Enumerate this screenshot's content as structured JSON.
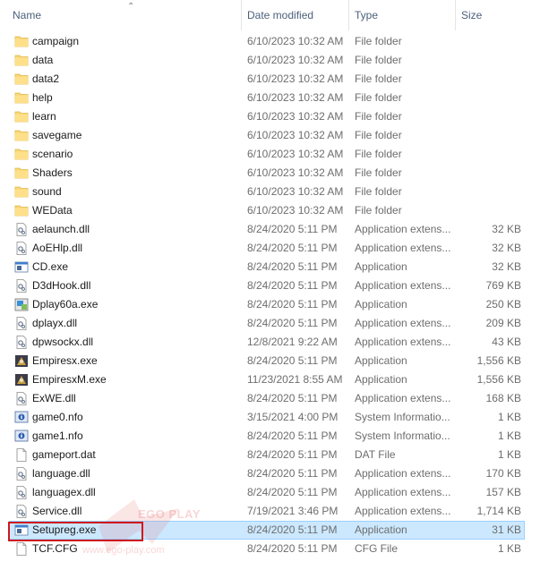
{
  "columns": {
    "name": "Name",
    "date": "Date modified",
    "type": "Type",
    "size": "Size"
  },
  "rows": [
    {
      "name": "campaign",
      "date": "6/10/2023 10:32 AM",
      "type": "File folder",
      "size": "",
      "icon": "folder"
    },
    {
      "name": "data",
      "date": "6/10/2023 10:32 AM",
      "type": "File folder",
      "size": "",
      "icon": "folder"
    },
    {
      "name": "data2",
      "date": "6/10/2023 10:32 AM",
      "type": "File folder",
      "size": "",
      "icon": "folder"
    },
    {
      "name": "help",
      "date": "6/10/2023 10:32 AM",
      "type": "File folder",
      "size": "",
      "icon": "folder"
    },
    {
      "name": "learn",
      "date": "6/10/2023 10:32 AM",
      "type": "File folder",
      "size": "",
      "icon": "folder"
    },
    {
      "name": "savegame",
      "date": "6/10/2023 10:32 AM",
      "type": "File folder",
      "size": "",
      "icon": "folder"
    },
    {
      "name": "scenario",
      "date": "6/10/2023 10:32 AM",
      "type": "File folder",
      "size": "",
      "icon": "folder"
    },
    {
      "name": "Shaders",
      "date": "6/10/2023 10:32 AM",
      "type": "File folder",
      "size": "",
      "icon": "folder"
    },
    {
      "name": "sound",
      "date": "6/10/2023 10:32 AM",
      "type": "File folder",
      "size": "",
      "icon": "folder"
    },
    {
      "name": "WEData",
      "date": "6/10/2023 10:32 AM",
      "type": "File folder",
      "size": "",
      "icon": "folder"
    },
    {
      "name": "aelaunch.dll",
      "date": "8/24/2020 5:11 PM",
      "type": "Application extens...",
      "size": "32 KB",
      "icon": "dll"
    },
    {
      "name": "AoEHlp.dll",
      "date": "8/24/2020 5:11 PM",
      "type": "Application extens...",
      "size": "32 KB",
      "icon": "dll"
    },
    {
      "name": "CD.exe",
      "date": "8/24/2020 5:11 PM",
      "type": "Application",
      "size": "32 KB",
      "icon": "exe"
    },
    {
      "name": "D3dHook.dll",
      "date": "8/24/2020 5:11 PM",
      "type": "Application extens...",
      "size": "769 KB",
      "icon": "dll"
    },
    {
      "name": "Dplay60a.exe",
      "date": "8/24/2020 5:11 PM",
      "type": "Application",
      "size": "250 KB",
      "icon": "setup"
    },
    {
      "name": "dplayx.dll",
      "date": "8/24/2020 5:11 PM",
      "type": "Application extens...",
      "size": "209 KB",
      "icon": "dll"
    },
    {
      "name": "dpwsockx.dll",
      "date": "12/8/2021 9:22 AM",
      "type": "Application extens...",
      "size": "43 KB",
      "icon": "dll"
    },
    {
      "name": "Empiresx.exe",
      "date": "8/24/2020 5:11 PM",
      "type": "Application",
      "size": "1,556 KB",
      "icon": "game"
    },
    {
      "name": "EmpiresxM.exe",
      "date": "11/23/2021 8:55 AM",
      "type": "Application",
      "size": "1,556 KB",
      "icon": "game"
    },
    {
      "name": "ExWE.dll",
      "date": "8/24/2020 5:11 PM",
      "type": "Application extens...",
      "size": "168 KB",
      "icon": "dll"
    },
    {
      "name": "game0.nfo",
      "date": "3/15/2021 4:00 PM",
      "type": "System Informatio...",
      "size": "1 KB",
      "icon": "nfo"
    },
    {
      "name": "game1.nfo",
      "date": "8/24/2020 5:11 PM",
      "type": "System Informatio...",
      "size": "1 KB",
      "icon": "nfo"
    },
    {
      "name": "gameport.dat",
      "date": "8/24/2020 5:11 PM",
      "type": "DAT File",
      "size": "1 KB",
      "icon": "file"
    },
    {
      "name": "language.dll",
      "date": "8/24/2020 5:11 PM",
      "type": "Application extens...",
      "size": "170 KB",
      "icon": "dll"
    },
    {
      "name": "languagex.dll",
      "date": "8/24/2020 5:11 PM",
      "type": "Application extens...",
      "size": "157 KB",
      "icon": "dll"
    },
    {
      "name": "Service.dll",
      "date": "7/19/2021 3:46 PM",
      "type": "Application extens...",
      "size": "1,714 KB",
      "icon": "dll"
    },
    {
      "name": "Setupreg.exe",
      "date": "8/24/2020 5:11 PM",
      "type": "Application",
      "size": "31 KB",
      "icon": "exe",
      "selected": true
    },
    {
      "name": "TCF.CFG",
      "date": "8/24/2020 5:11 PM",
      "type": "CFG File",
      "size": "1 KB",
      "icon": "file"
    }
  ],
  "watermark": {
    "brand": "EGO PLAY",
    "url": "www.ego-play.com"
  },
  "colors": {
    "folder": "#f8d775",
    "selection": "#cce8ff",
    "highlight": "#d0161e"
  }
}
